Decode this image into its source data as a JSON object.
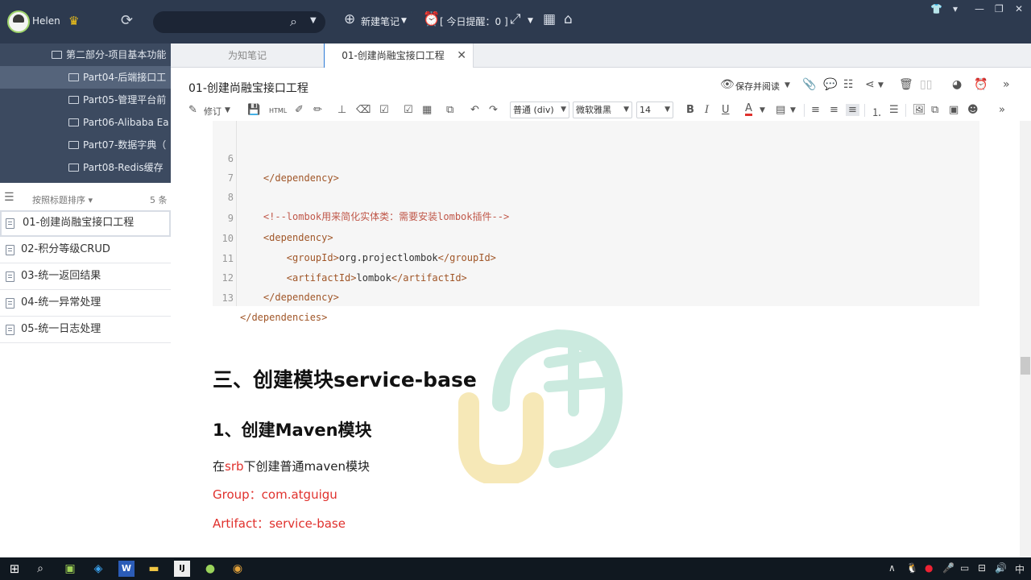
{
  "topbar": {
    "username": "Helen",
    "new_note_label": "新建笔记",
    "reminder_label": "[ 今日提醒：0 ]",
    "icons": [
      "sync-icon",
      "search-icon",
      "plus-circle-icon",
      "alarm-icon",
      "expand-icon",
      "grid-icon",
      "home-icon"
    ]
  },
  "sidebar": {
    "tree": [
      {
        "label": "第二部分-项目基本功能",
        "level": 1,
        "selected": false
      },
      {
        "label": "Part04-后端接口工",
        "level": 2,
        "selected": true
      },
      {
        "label": "Part05-管理平台前",
        "level": 2,
        "selected": false
      },
      {
        "label": "Part06-Alibaba Ea",
        "level": 2,
        "selected": false
      },
      {
        "label": "Part07-数据字典（",
        "level": 2,
        "selected": false
      },
      {
        "label": "Part08-Redis缓存",
        "level": 2,
        "selected": false
      }
    ],
    "sort_label": "按照标题排序",
    "count_label": "5 条",
    "notes": [
      {
        "title": "01-创建尚融宝接口工程",
        "selected": true
      },
      {
        "title": "02-积分等级CRUD",
        "selected": false
      },
      {
        "title": "03-统一返回结果",
        "selected": false
      },
      {
        "title": "04-统一异常处理",
        "selected": false
      },
      {
        "title": "05-统一日志处理",
        "selected": false
      }
    ]
  },
  "tabs": [
    {
      "label": "为知笔记",
      "active": false
    },
    {
      "label": "01-创建尚融宝接口工程",
      "active": true
    }
  ],
  "note": {
    "title": "01-创建尚融宝接口工程",
    "save_read_label": "保存并阅读"
  },
  "format_bar": {
    "revise_label": "修订",
    "paragraph_style": "普通 (div)",
    "font_family": "微软雅黑",
    "font_size": "14"
  },
  "code": {
    "lines": [
      {
        "n": "6",
        "text": "    </dependency>",
        "kind": "tag"
      },
      {
        "n": "7",
        "text": "",
        "kind": "tag"
      },
      {
        "n": "8",
        "text": "    <!--lombok用来简化实体类：需要安装lombok插件-->",
        "kind": "comment"
      },
      {
        "n": "9",
        "text": "    <dependency>",
        "kind": "tag"
      },
      {
        "n": "10",
        "text": "        <groupId>org.projectlombok</groupId>",
        "kind": "mixed"
      },
      {
        "n": "11",
        "text": "        <artifactId>lombok</artifactId>",
        "kind": "mixed"
      },
      {
        "n": "12",
        "text": "    </dependency>",
        "kind": "tag"
      },
      {
        "n": "13",
        "text": "</dependencies>",
        "kind": "tag"
      }
    ]
  },
  "doc": {
    "h2": "三、创建模块service-base",
    "h3": "1、创建Maven模块",
    "p1_prefix": "在",
    "p1_highlight": "srb",
    "p1_suffix": "下创建普通maven模块",
    "p2": "Group：com.atguigu",
    "p3": "Artifact：service-base"
  },
  "taskbar": {
    "ime": "中",
    "apps": [
      "windows-start-icon",
      "search-icon",
      "terminal-icon",
      "vscode-icon",
      "word-icon",
      "explorer-icon",
      "intellij-icon",
      "wiznote-icon",
      "chrome-icon"
    ]
  },
  "colors": {
    "topbar_bg": "#2d3a4f",
    "tree_bg": "#3c4a60",
    "accent": "#2d7bd6",
    "red_text": "#e0312d"
  }
}
